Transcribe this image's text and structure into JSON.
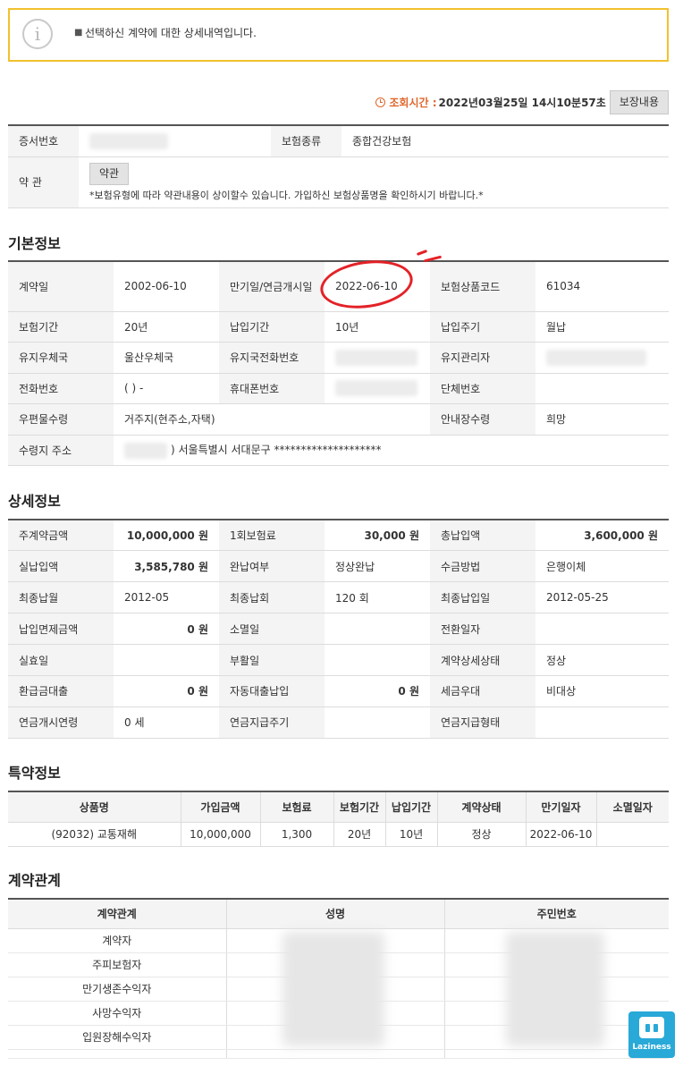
{
  "notice": {
    "message": "선택하신 계약에 대한 상세내역입니다."
  },
  "query_time": {
    "label": "조회시간 :",
    "value": "2022년03월25일 14시10분57초"
  },
  "coverage_button": "보장내용",
  "policy": {
    "cert_no_label": "증서번호",
    "insurance_type_label": "보험종류",
    "insurance_type_value": "종합건강보험",
    "terms_label": "약 관",
    "terms_button": "약관",
    "terms_note": "*보험유형에 따라 약관내용이 상이할수 있습니다. 가입하신 보험상품명을 확인하시기 바랍니다.*"
  },
  "basic": {
    "title": "기본정보",
    "rows": [
      [
        "계약일",
        "2002-06-10",
        "만기일/연금개시일",
        "2022-06-10",
        "보험상품코드",
        "61034"
      ],
      [
        "보험기간",
        "20년",
        "납입기간",
        "10년",
        "납입주기",
        "월납"
      ],
      [
        "유지우체국",
        "울산우체국",
        "유지국전화번호",
        "",
        "유지관리자",
        ""
      ],
      [
        "전화번호",
        "( ) -",
        "휴대폰번호",
        "",
        "단체번호",
        ""
      ],
      [
        "우편물수령",
        "거주지(현주소,자택)",
        "",
        "",
        "안내장수령",
        "희망"
      ]
    ],
    "addr_label": "수령지 주소",
    "addr_value": ") 서울특별시 서대문구 ********************"
  },
  "detail": {
    "title": "상세정보",
    "rows": [
      [
        "주계약금액",
        "10,000,000 원",
        "1회보험료",
        "30,000 원",
        "총납입액",
        "3,600,000 원"
      ],
      [
        "실납입액",
        "3,585,780 원",
        "완납여부",
        "정상완납",
        "수금방법",
        "은행이체"
      ],
      [
        "최종납월",
        "2012-05",
        "최종납회",
        "120 회",
        "최종납입일",
        "2012-05-25"
      ],
      [
        "납입면제금액",
        "0 원",
        "소멸일",
        "",
        "전환일자",
        ""
      ],
      [
        "실효일",
        "",
        "부활일",
        "",
        "계약상세상태",
        "정상"
      ],
      [
        "환급금대출",
        "0 원",
        "자동대출납입",
        "0 원",
        "세금우대",
        "비대상"
      ],
      [
        "연금개시연령",
        "0 세",
        "연금지급주기",
        "",
        "연금지급형태",
        ""
      ]
    ]
  },
  "rider": {
    "title": "특약정보",
    "headers": [
      "상품명",
      "가입금액",
      "보험료",
      "보험기간",
      "납입기간",
      "계약상태",
      "만기일자",
      "소멸일자"
    ],
    "row": [
      "(92032) 교통재해",
      "10,000,000",
      "1,300",
      "20년",
      "10년",
      "정상",
      "2022-06-10",
      ""
    ]
  },
  "relation": {
    "title": "계약관계",
    "headers": [
      "계약관계",
      "성명",
      "주민번호"
    ],
    "rows": [
      "계약자",
      "주피보험자",
      "만기생존수익자",
      "사망수익자",
      "입원장해수익자"
    ]
  },
  "logo": {
    "text": "Laziness"
  },
  "colors": {
    "accent": "#e0662b",
    "notice_border": "#f2c12e",
    "highlight_circle": "#e32227",
    "logo_bg": "#28a9d8"
  }
}
